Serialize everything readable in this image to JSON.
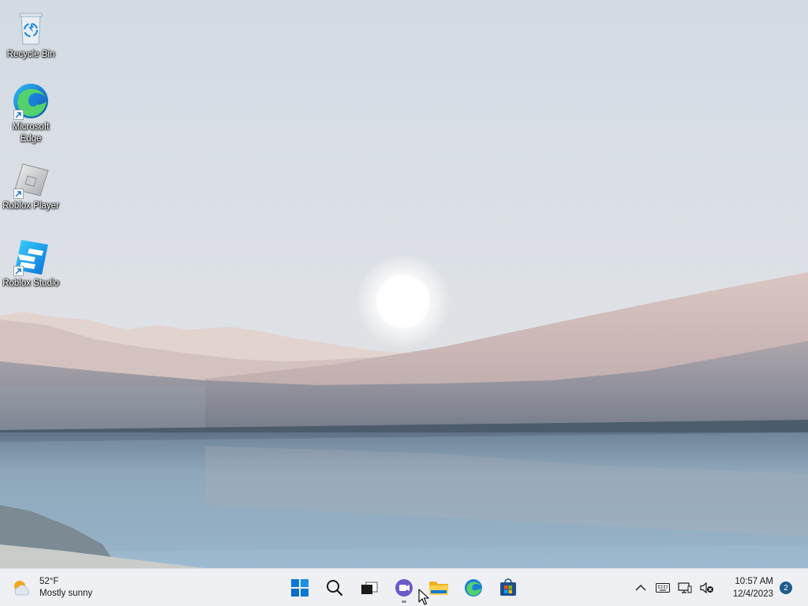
{
  "desktop": {
    "icons": [
      {
        "label": "Recycle Bin",
        "icon": "recycle-bin-icon"
      },
      {
        "label": "Microsoft Edge",
        "icon": "edge-icon"
      },
      {
        "label": "Roblox Player",
        "icon": "roblox-player-icon"
      },
      {
        "label": "Roblox Studio",
        "icon": "roblox-studio-icon"
      }
    ]
  },
  "taskbar": {
    "weather": {
      "temp": "52°F",
      "condition": "Mostly sunny",
      "icon": "sun-cloud-icon"
    },
    "apps": [
      {
        "name": "Start",
        "icon": "windows-start-icon"
      },
      {
        "name": "Search",
        "icon": "search-icon"
      },
      {
        "name": "Task View",
        "icon": "task-view-icon"
      },
      {
        "name": "Chat",
        "icon": "chat-icon"
      },
      {
        "name": "File Explorer",
        "icon": "folder-icon"
      },
      {
        "name": "Microsoft Edge",
        "icon": "edge-icon"
      },
      {
        "name": "Microsoft Store",
        "icon": "store-icon"
      }
    ],
    "tray": {
      "time": "10:57 AM",
      "date": "12/4/2023",
      "notification_count": "2"
    }
  },
  "colors": {
    "taskbar_bg": "#eef0f4",
    "accent": "#0078d4",
    "notification_badge": "#1d5d8c"
  }
}
